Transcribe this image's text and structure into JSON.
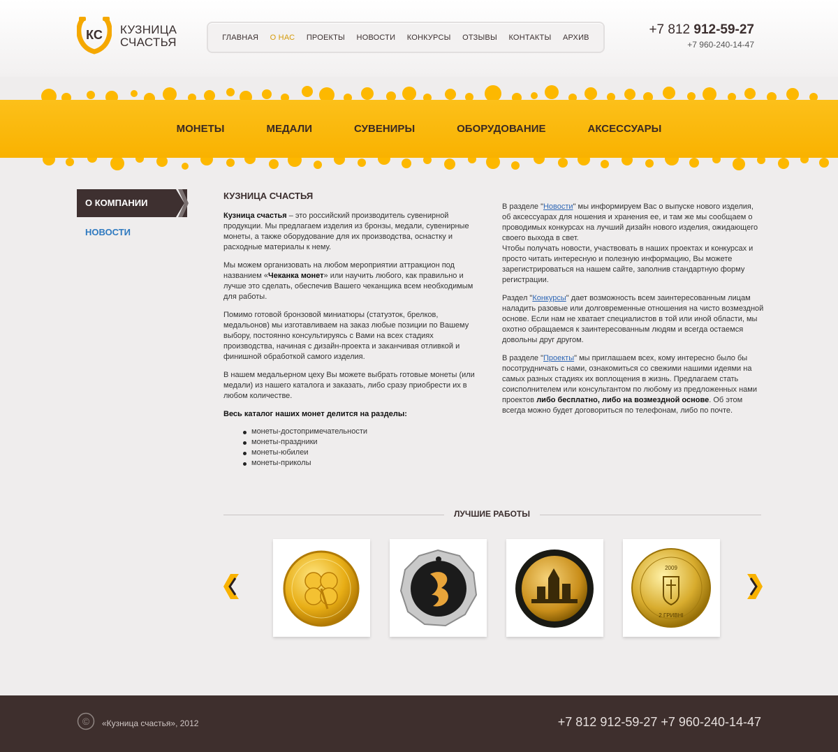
{
  "brand": {
    "logo_text": "КС",
    "name_line1": "КУЗНИЦА",
    "name_line2": "СЧАСТЬЯ"
  },
  "top_nav": {
    "items": [
      {
        "label": "ГЛАВНАЯ",
        "active": false
      },
      {
        "label": "О НАС",
        "active": true
      },
      {
        "label": "ПРОЕКТЫ",
        "active": false
      },
      {
        "label": "НОВОСТИ",
        "active": false
      },
      {
        "label": "КОНКУРСЫ",
        "active": false
      },
      {
        "label": "ОТЗЫВЫ",
        "active": false
      },
      {
        "label": "КОНТАКТЫ",
        "active": false
      },
      {
        "label": "АРХИВ",
        "active": false
      }
    ]
  },
  "phones": {
    "main_prefix": "+7 812",
    "main_number": "912-59-27",
    "second": "+7 960-240-14-47"
  },
  "category_nav": {
    "items": [
      "МОНЕТЫ",
      "МЕДАЛИ",
      "СУВЕНИРЫ",
      "ОБОРУДОВАНИЕ",
      "АКСЕССУАРЫ"
    ]
  },
  "sidebar": {
    "active": "О КОМПАНИИ",
    "link": "НОВОСТИ"
  },
  "content": {
    "title": "КУЗНИЦА СЧАСТЬЯ",
    "p1_bold": "Кузница счастья",
    "p1_rest": " – это российский производитель сувенирной продукции. Мы предлагаем изделия из бронзы, медали, сувенирные монеты,  а также оборудование для их производства,  оснастку и расходные материалы к нему.",
    "p2_start": "Мы можем организовать на любом мероприятии аттракцион под названием «",
    "p2_bold": "Чеканка монет",
    "p2_end": "» или научить любого, как правильно и лучше это сделать, обеспечив Вашего чеканщика всем необходимым для работы.",
    "p3": "Помимо готовой бронзовой миниатюры (статуэток, брелков, медальонов) мы изготавливаем  на заказ любые позиции по Вашему выбору, постоянно консультируясь с Вами на всех стадиях производства, начиная с дизайн-проекта и заканчивая отливкой и финишной обработкой самого изделия.",
    "p4": "В нашем медальерном цеху Вы можете выбрать готовые монеты (или медали) из нашего каталога и заказать, либо сразу приобрести их в любом количестве.",
    "catalog_heading": "Весь каталог наших монет делится на разделы:",
    "catalog_items": [
      "монеты-достопримечательности",
      "монеты-праздники",
      "монеты-юбилеи",
      "монеты-приколы"
    ],
    "r1_start": "В разделе \"",
    "r1_link": "Новости",
    "r1_end": "\" мы информируем Вас о выпуске нового изделия, об аксессуарах для ношения и хранения ее, и там же мы сообщаем о проводимых конкурсах на лучший дизайн нового изделия, ожидающего своего выхода в свет.",
    "r1_cont": "Чтобы получать новости, участвовать в наших проектах и конкурсах и просто читать интересную и полезную информацию, Вы можете зарегистрироваться на нашем сайте, заполнив стандартную форму регистрации.",
    "r2_start": "Раздел \"",
    "r2_link": "Конкурсы",
    "r2_end": "\" дает возможность всем заинтересованным лицам наладить разовые или долговременные отношения на чисто возмездной основе. Если нам не хватает специалистов в той или иной области, мы охотно обращаемся к заинтересованным людям и всегда остаемся довольны друг другом.",
    "r3_start": "В разделе \"",
    "r3_link": "Проекты",
    "r3_mid": "\" мы приглашаем всех, кому интересно было бы посотрудничать с нами, ознакомиться со свежими нашими идеями на самых разных стадиях их воплощения в жизнь. Предлагаем стать соисполнителем или консультантом по любому из предложенных нами проектов ",
    "r3_bold": "либо бесплатно, либо на возмездной основе",
    "r3_end": ". Об этом всегда можно будет договориться по телефонам, либо по почте."
  },
  "best_works": {
    "title": "ЛУЧШИЕ РАБОТЫ",
    "prev_label": "‹",
    "next_label": "›",
    "items": [
      {
        "name": "gold-clover-coin"
      },
      {
        "name": "silver-octagon-coin"
      },
      {
        "name": "gold-city-coin"
      },
      {
        "name": "gold-ukraine-coin",
        "coin_year": "2009",
        "coin_value": "2 ГРИВНІ"
      }
    ]
  },
  "footer": {
    "copy_symbol": "©",
    "copyright": "«Кузница счастья», 2012",
    "phones": "+7 812 912-59-27 +7 960-240-14-47"
  },
  "colors": {
    "accent_yellow": "#f9b200",
    "dark_brown": "#3e2f2d",
    "link_blue": "#2f67b5",
    "active_nav": "#d49a08"
  }
}
